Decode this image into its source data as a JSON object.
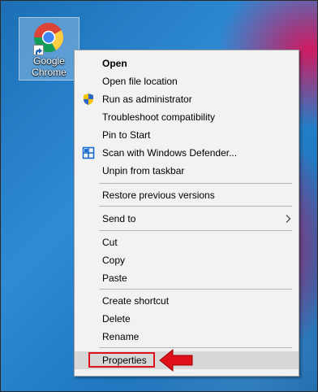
{
  "desktop": {
    "icon": {
      "label_line1": "Google",
      "label_line2": "Chrome",
      "icon_name": "chrome-icon"
    }
  },
  "context_menu": {
    "items": [
      {
        "label": "Open",
        "bold": true
      },
      {
        "label": "Open file location"
      },
      {
        "label": "Run as administrator",
        "icon": "uac-shield-icon"
      },
      {
        "label": "Troubleshoot compatibility"
      },
      {
        "label": "Pin to Start"
      },
      {
        "label": "Scan with Windows Defender...",
        "icon": "windows-defender-icon"
      },
      {
        "label": "Unpin from taskbar"
      },
      {
        "label": "Restore previous versions"
      },
      {
        "label": "Send to",
        "submenu": true
      },
      {
        "label": "Cut"
      },
      {
        "label": "Copy"
      },
      {
        "label": "Paste"
      },
      {
        "label": "Create shortcut"
      },
      {
        "label": "Delete"
      },
      {
        "label": "Rename"
      },
      {
        "label": "Properties",
        "highlighted": true
      }
    ]
  },
  "colors": {
    "highlight_border": "#e0101a",
    "menu_background": "#f2f2f2",
    "hover_background": "#d8d8d8"
  }
}
